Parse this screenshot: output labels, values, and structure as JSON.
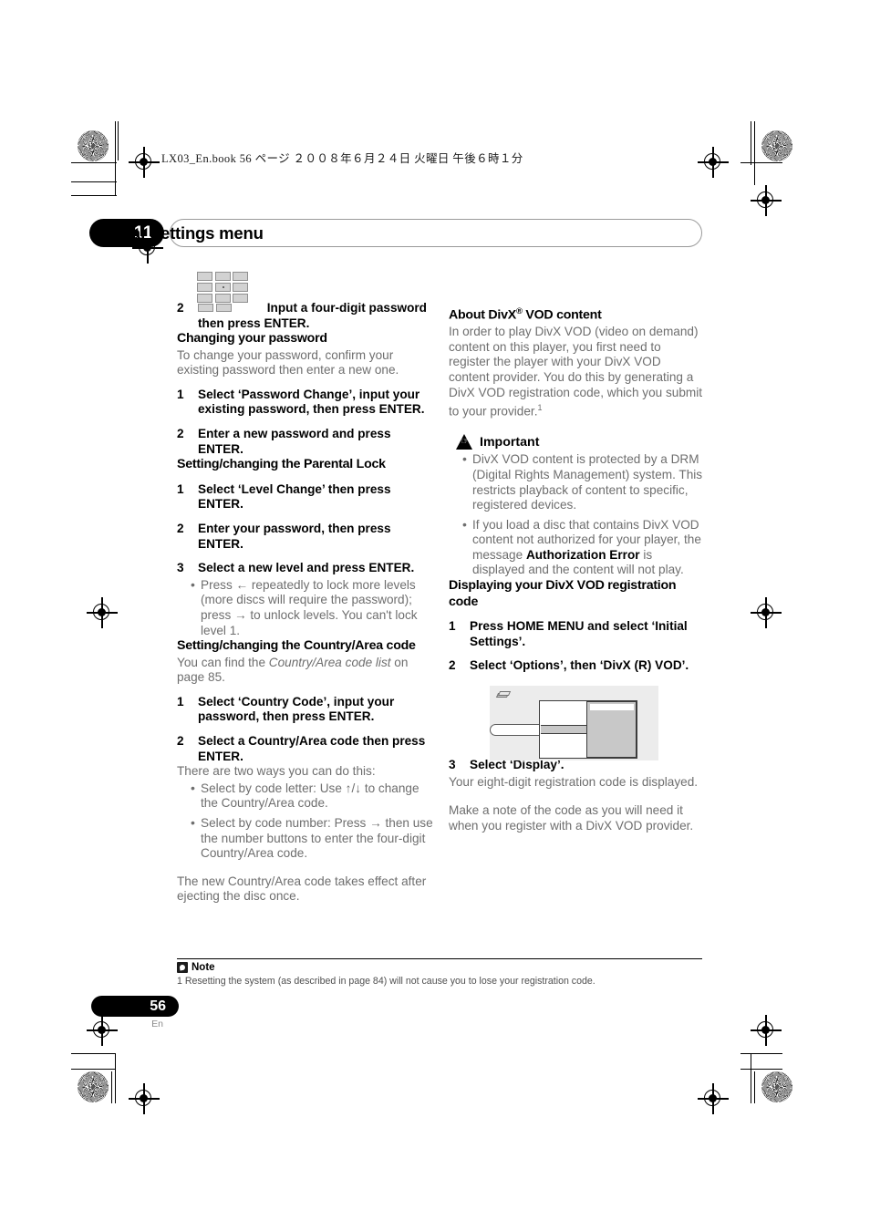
{
  "page": {
    "file_header": "LX03_En.book   56 ページ   ２００８年６月２４日   火曜日   午後６時１分",
    "number": "56",
    "language": "En"
  },
  "chapter": {
    "number": "11",
    "title": "Initial Settings menu"
  },
  "left_column": {
    "step_keypad": {
      "number": "2",
      "icon": "numeric-keypad-icon",
      "text": "Input a four-digit password then press ENTER."
    },
    "sections": [
      {
        "heading": "Changing your password",
        "body": "To change your password, confirm your existing password then enter a new one.",
        "steps": [
          {
            "number": "1",
            "text": "Select ‘Password Change’, input your existing password, then press ENTER."
          },
          {
            "number": "2",
            "text": "Enter a new password and press ENTER."
          }
        ]
      },
      {
        "heading": "Setting/changing the Parental Lock",
        "steps": [
          {
            "number": "1",
            "text": "Select ‘Level Change’ then press ENTER."
          },
          {
            "number": "2",
            "text": "Enter your password, then press ENTER."
          },
          {
            "number": "3",
            "text": "Select a new level and press ENTER."
          }
        ],
        "bullets": [
          "Press ← repeatedly to lock more levels (more discs will require the password); press → to unlock levels. You can't lock level 1."
        ]
      },
      {
        "heading": "Setting/changing the Country/Area code",
        "body_pre": "You can find the ",
        "body_italic": "Country/Area code list",
        "body_post": " on page 85.",
        "steps": [
          {
            "number": "1",
            "text": "Select ‘Country Code’, input your password, then press ENTER."
          },
          {
            "number": "2",
            "text": "Select a Country/Area code then press ENTER."
          }
        ],
        "body_after_steps": "There are two ways you can do this:",
        "bullets": [
          "Select by code letter: Use ↑/↓ to change the Country/Area code.",
          "Select by code number: Press → then use the number buttons to enter the four-digit Country/Area code."
        ],
        "body_closing": "The new Country/Area code takes effect after ejecting the disc once."
      }
    ]
  },
  "right_column": {
    "about": {
      "heading_pre": "About DivX",
      "heading_tm": "®",
      "heading_post": " VOD content",
      "body": "In order to play DivX VOD (video on demand) content on this player, you first need to register the player with your DivX VOD content provider. You do this by generating a DivX VOD registration code, which you submit to your provider.",
      "footnote_marker": "1"
    },
    "important": {
      "icon": "warning-triangle-hand-icon",
      "label": "Important",
      "bullets": [
        {
          "pre": "DivX VOD content is protected by a DRM (Digital Rights Management) system. This restricts playback of content to specific, registered devices.",
          "bold": "",
          "post": ""
        },
        {
          "pre": "If you load a disc that contains DivX VOD content not authorized for your player, the message ",
          "bold": "Authorization Error",
          "post": " is displayed and the content will not play."
        }
      ]
    },
    "displaying": {
      "heading": "Displaying your DivX VOD registration code",
      "steps": [
        {
          "number": "1",
          "text": "Press HOME MENU and select ‘Initial Settings’."
        },
        {
          "number": "2",
          "text": "Select ‘Options’, then ‘DivX (R) VOD’."
        },
        {
          "number": "3",
          "text": "Select ‘Display’."
        }
      ],
      "body_after": "Your eight-digit registration code is displayed.",
      "body_closing": "Make a note of the code as you will need it when you register with a DivX VOD provider."
    },
    "ui_mock": {
      "icon": "disc-tag-icon"
    }
  },
  "footer": {
    "note_icon": "note-pencil-icon",
    "note_label": "Note",
    "note_text": "1 Resetting the system (as described in page 84) will not cause you to lose your registration code."
  }
}
